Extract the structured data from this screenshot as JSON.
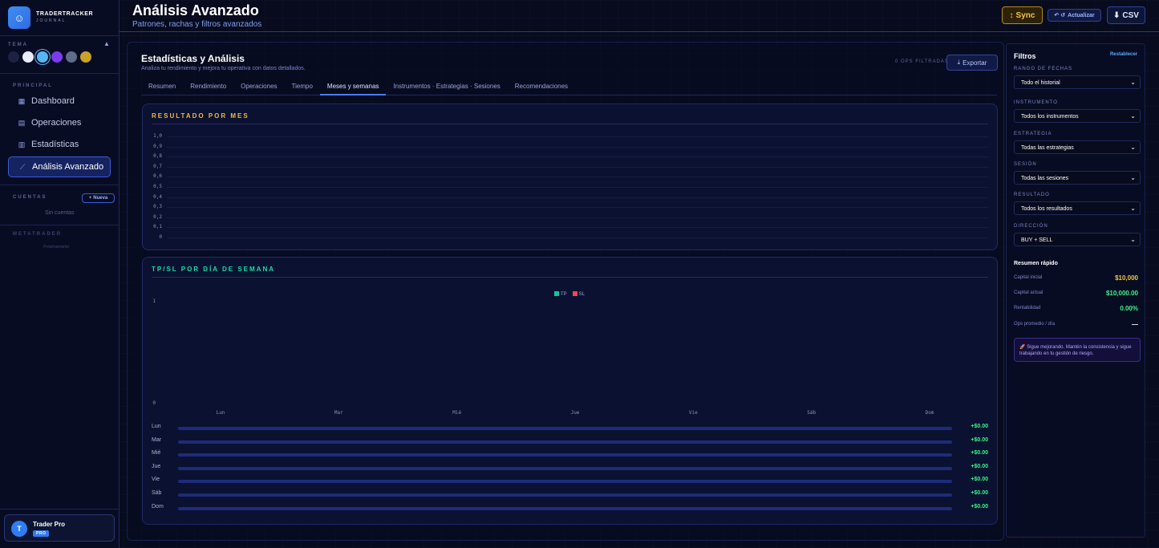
{
  "app": {
    "brand": "TRADERTRACKER",
    "brand_sub": "JOURNAL",
    "logo_icon": "bot-icon"
  },
  "sidebar": {
    "tema_label": "TEMA",
    "themes": [
      "#1c2240",
      "#e8ecf8",
      "#55b6f2",
      "#7c3aed",
      "#5d6d8a",
      "#c9a227"
    ],
    "principal_label": "PRINCIPAL",
    "nav": [
      {
        "label": "Dashboard",
        "icon": "grid-icon"
      },
      {
        "label": "Operaciones",
        "icon": "table-icon"
      },
      {
        "label": "Estadísticas",
        "icon": "bar-chart-icon"
      },
      {
        "label": "Análisis Avanzado",
        "icon": "trend-icon",
        "active": true
      }
    ],
    "cuentas_label": "CUENTAS",
    "nueva": "Nueva",
    "sin_cuentas": "Sin cuentas",
    "metatrader_label": "METATRADER",
    "proximamente": "Próximamente",
    "user": {
      "initial": "T",
      "name": "Trader Pro",
      "badge": "PRO"
    }
  },
  "header": {
    "title": "Análisis Avanzado",
    "subtitle": "Patrones, rachas y filtros avanzados",
    "sync": "Sync",
    "actualizar": "Actualizar",
    "csv": "CSV"
  },
  "main": {
    "title": "Estadísticas y Análisis",
    "subtitle": "Analiza tu rendimiento y mejora tu operativa con datos detallados.",
    "ops_filtradas": "0 OPS FILTRADAS",
    "exportar": "Exportar",
    "tabs": [
      "Resumen",
      "Rendimiento",
      "Operaciones",
      "Tiempo",
      "Meses y semanas",
      "Instrumentos · Estrategias · Sesiones",
      "Recomendaciones"
    ],
    "active_tab": 4
  },
  "chart_data": [
    {
      "type": "bar",
      "title": "RESULTADO POR MES",
      "ylim": [
        0,
        1
      ],
      "y_ticks": [
        "1,0",
        "0,9",
        "0,8",
        "0,7",
        "0,6",
        "0,5",
        "0,4",
        "0,3",
        "0,2",
        "0,1",
        "0"
      ],
      "categories": [],
      "values": []
    },
    {
      "type": "bar",
      "title": "TP/SL POR DÍA DE SEMANA",
      "categories": [
        "Lun",
        "Mar",
        "Mié",
        "Jue",
        "Vie",
        "Sáb",
        "Dom"
      ],
      "y_ticks": [
        "1",
        "0"
      ],
      "ylim": [
        0,
        1
      ],
      "series": [
        {
          "name": "TP",
          "color": "#10c9a0",
          "values": [
            0,
            0,
            0,
            0,
            0,
            0,
            0
          ]
        },
        {
          "name": "SL",
          "color": "#f0455a",
          "values": [
            0,
            0,
            0,
            0,
            0,
            0,
            0
          ]
        }
      ]
    }
  ],
  "day_results": [
    {
      "day": "Lun",
      "value": "+$0.00"
    },
    {
      "day": "Mar",
      "value": "+$0.00"
    },
    {
      "day": "Mié",
      "value": "+$0.00"
    },
    {
      "day": "Jue",
      "value": "+$0.00"
    },
    {
      "day": "Vie",
      "value": "+$0.00"
    },
    {
      "day": "Sáb",
      "value": "+$0.00"
    },
    {
      "day": "Dom",
      "value": "+$0.00"
    }
  ],
  "filters": {
    "title": "Filtros",
    "reset": "Restablecer",
    "fields": [
      {
        "label": "RANGO DE FECHAS",
        "value": "Todo el historial"
      },
      {
        "label": "INSTRUMENTO",
        "value": "Todos los instrumentos"
      },
      {
        "label": "ESTRATEGIA",
        "value": "Todas las estrategias"
      },
      {
        "label": "SESIÓN",
        "value": "Todas las sesiones"
      },
      {
        "label": "RESULTADO",
        "value": "Todos los resultados"
      },
      {
        "label": "DIRECCIÓN",
        "value": "BUY + SELL"
      }
    ],
    "resumen_title": "Resumen rápido",
    "resumen": [
      {
        "label": "Capital inicial",
        "value": "$10,000",
        "color": "#f5c542"
      },
      {
        "label": "Capital actual",
        "value": "$10,000.00",
        "color": "#3ef58a"
      },
      {
        "label": "Rentabilidad",
        "value": "0.00%",
        "color": "#3ef58a"
      },
      {
        "label": "Ops promedio / día",
        "value": "—",
        "color": "#ffffff"
      }
    ],
    "tip": "🚀 Sigue mejorando. Mantén la consistencia y sigue trabajando en tu gestión de riesgo."
  }
}
